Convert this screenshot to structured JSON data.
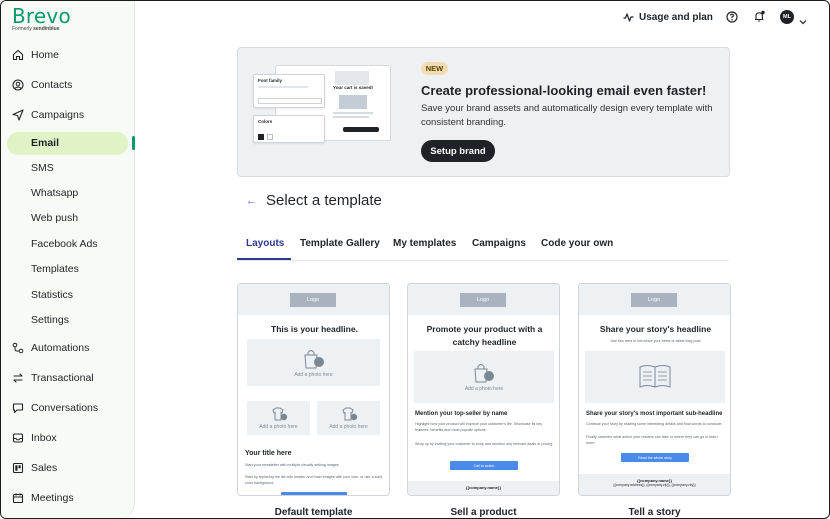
{
  "brand": {
    "name": "Brevo",
    "formerly_prefix": "Formerly",
    "formerly_name": "sendinblue",
    "color": "#0b996e"
  },
  "topbar": {
    "usage_label": "Usage and plan",
    "avatar_initials": "ML"
  },
  "sidebar": {
    "items": [
      {
        "label": "Home",
        "icon": "home-icon"
      },
      {
        "label": "Contacts",
        "icon": "contacts-icon"
      },
      {
        "label": "Campaigns",
        "icon": "send-icon"
      }
    ],
    "campaign_sub": [
      "Email",
      "SMS",
      "Whatsapp",
      "Web push",
      "Facebook Ads",
      "Templates",
      "Statistics",
      "Settings"
    ],
    "items_bottom": [
      {
        "label": "Automations",
        "icon": "automations-icon"
      },
      {
        "label": "Transactional",
        "icon": "transactional-icon"
      },
      {
        "label": "Conversations",
        "icon": "chat-icon"
      },
      {
        "label": "Inbox",
        "icon": "inbox-icon"
      },
      {
        "label": "Sales",
        "icon": "sales-icon"
      },
      {
        "label": "Meetings",
        "icon": "calendar-icon"
      }
    ],
    "active_item": "Email"
  },
  "banner": {
    "badge": "NEW",
    "title": "Create professional-looking email even faster!",
    "description": "Save your brand assets and automatically design every template with consistent branding.",
    "button": "Setup brand",
    "mock": {
      "font_family_label": "Font family",
      "colors_label": "Colors",
      "cart_title": "Your cart is saved!"
    }
  },
  "section": {
    "title": "Select a template"
  },
  "tabs": [
    "Layouts",
    "Template Gallery",
    "My templates",
    "Campaigns",
    "Code your own"
  ],
  "active_tab": "Layouts",
  "templates": [
    {
      "logo": "Logo",
      "headline": "This is your headline.",
      "photo_label": "Add a photo here",
      "sub_photo_label": "Add a photo here",
      "subtitle": "Your title here",
      "body1": "Start your newsletter with multiple visually striking images",
      "body2": "Start by replacing the list with header and main images with your own, or use a solid color background",
      "name": "Default template"
    },
    {
      "logo": "Logo",
      "headline": "Promote your product with a catchy headline",
      "photo_label": "Add a photo here",
      "subtitle": "Mention your top-seller by name",
      "body1": "Highlight how your product will improve your customer's life. Showcase its key features, benefits and most popular options.",
      "body2": "Wrap up by inviting your customer to shop and mention any relevant deals or pricing.",
      "button": "Call to action",
      "company": "{{company.name}}",
      "name": "Sell a product"
    },
    {
      "logo": "Logo",
      "headline": "Share your story's headline",
      "intro": "Use this area to introduce your news or latest blog post",
      "subtitle": "Share your story's most important sub-headline",
      "body1": "Continue your story by sharing some interesting details and final words to conclude.",
      "body2": "Finally, describe what action your readers can take or where they can go to learn more.",
      "button": "Read the whole story",
      "company": "{{company.name}}",
      "company_address": "{{company.address}}, {{company.zip}}, {{company.city}}",
      "name": "Tell a story"
    }
  ]
}
